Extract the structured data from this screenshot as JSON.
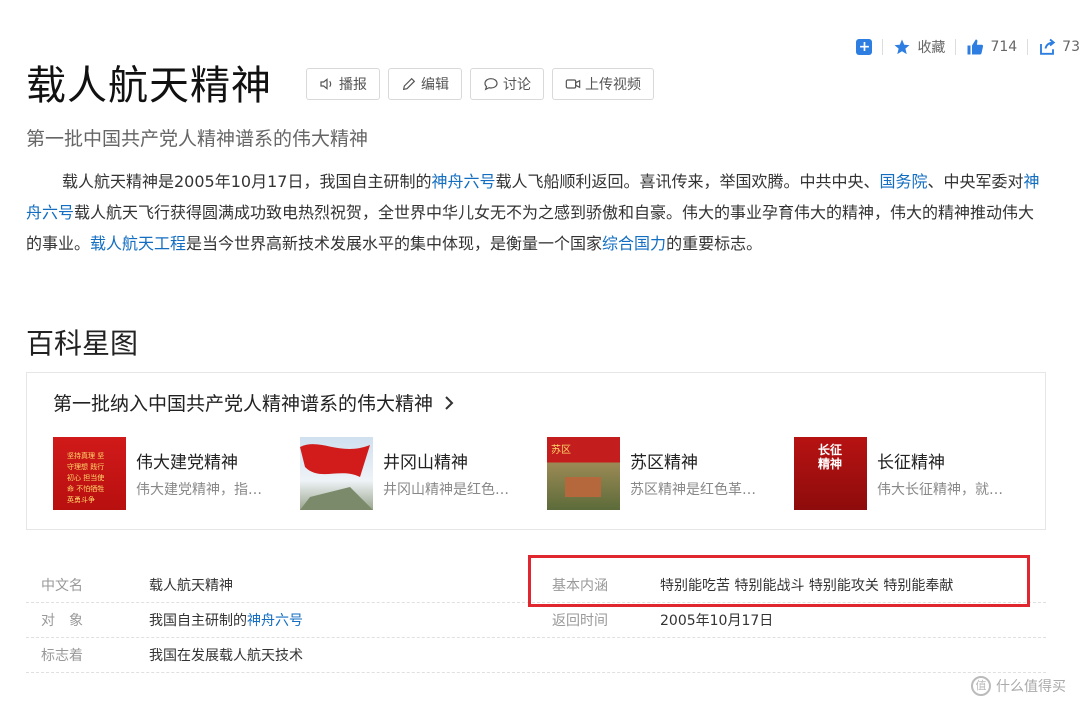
{
  "stats": {
    "collect": "收藏",
    "likes": "714",
    "shares": "73"
  },
  "title": "载人航天精神",
  "buttons": {
    "broadcast": "播报",
    "edit": "编辑",
    "discuss": "讨论",
    "upload_video": "上传视频"
  },
  "subtitle": "第一批中国共产党人精神谱系的伟大精神",
  "para": {
    "t1": "载人航天精神是2005年10月17日，我国自主研制的",
    "l1": "神舟六号",
    "t2": "载人飞船顺利返回。喜讯传来，举国欢腾。中共中央、",
    "l2": "国务院",
    "t3": "、中央军委对",
    "l3": "神舟六号",
    "t4": "载人航天飞行获得圆满成功致电热烈祝贺，全世界中华儿女无不为之感到骄傲和自豪。伟大的事业孕育伟大的精神，伟大的精神推动伟大的事业。",
    "l4": "载人航天工程",
    "t5": "是当今世界高新技术发展水平的集中体现，是衡量一个国家",
    "l5": "综合国力",
    "t6": "的重要标志。"
  },
  "section_title": "百科星图",
  "card": {
    "title": "第一批纳入中国共产党人精神谱系的伟大精神",
    "items": [
      {
        "name": "伟大建党精神",
        "desc": "伟大建党精神，指…",
        "thumb_text": "坚持真理 坚守理想 践行初心 担当使命 不怕牺牲 英勇斗争"
      },
      {
        "name": "井冈山精神",
        "desc": "井冈山精神是红色…",
        "thumb_text": ""
      },
      {
        "name": "苏区精神",
        "desc": "苏区精神是红色革…",
        "thumb_text": "苏区"
      },
      {
        "name": "长征精神",
        "desc": "伟大长征精神，就…",
        "thumb_text": "长征精神"
      }
    ]
  },
  "info": {
    "r1": {
      "l1": "中文名",
      "v1": "载人航天精神",
      "l2": "基本内涵",
      "v2": "特别能吃苦 特别能战斗 特别能攻关 特别能奉献"
    },
    "r2": {
      "l1": "对　象",
      "v1": "我国自主研制的",
      "v1_link": "神舟六号",
      "l2": "返回时间",
      "v2": "2005年10月17日"
    },
    "r3": {
      "l1": "标志着",
      "v1": "我国在发展载人航天技术"
    }
  },
  "watermark": {
    "logo": "值",
    "text": "什么值得买"
  },
  "colors": {
    "link": "#136ec2",
    "highlight_box": "#e0262e",
    "accent": "#2d7ee0"
  }
}
